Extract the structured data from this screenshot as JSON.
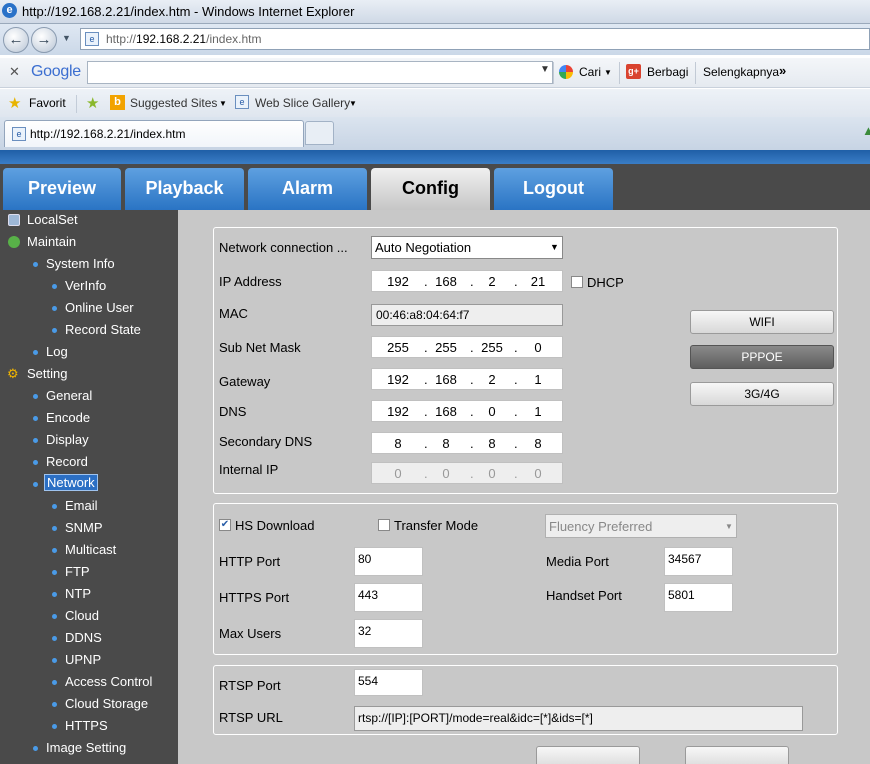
{
  "window": {
    "title": "http://192.168.2.21/index.htm - Windows Internet Explorer"
  },
  "address_bar": {
    "prefix": "http://",
    "host": "192.168.2.21",
    "path": "/index.htm"
  },
  "google_toolbar": {
    "logo": "Google",
    "search_label": "Cari",
    "share_label": "Berbagi",
    "more_label": "Selengkapnya"
  },
  "favorites_bar": {
    "favorites": "Favorit",
    "suggested": "Suggested Sites",
    "webslice": "Web Slice Gallery"
  },
  "tab": {
    "title": "http://192.168.2.21/index.htm"
  },
  "nav_tabs": [
    "Preview",
    "Playback",
    "Alarm",
    "Config",
    "Logout"
  ],
  "sidebar": {
    "localset": "LocalSet",
    "maintain": "Maintain",
    "system_info": "System Info",
    "verinfo": "VerInfo",
    "online_user": "Online User",
    "record_state": "Record State",
    "log": "Log",
    "setting": "Setting",
    "general": "General",
    "encode": "Encode",
    "display": "Display",
    "record": "Record",
    "network": "Network",
    "email": "Email",
    "snmp": "SNMP",
    "multicast": "Multicast",
    "ftp": "FTP",
    "ntp": "NTP",
    "cloud": "Cloud",
    "ddns": "DDNS",
    "upnp": "UPNP",
    "access_control": "Access Control",
    "cloud_storage": "Cloud Storage",
    "https": "HTTPS",
    "image_setting": "Image Setting"
  },
  "network": {
    "conn_label": "Network connection ...",
    "conn_value": "Auto Negotiation",
    "ip_label": "IP Address",
    "ip": [
      "192",
      "168",
      "2",
      "21"
    ],
    "dhcp_label": "DHCP",
    "mac_label": "MAC",
    "mac": "00:46:a8:04:64:f7",
    "mask_label": "Sub Net Mask",
    "mask": [
      "255",
      "255",
      "255",
      "0"
    ],
    "gateway_label": "Gateway",
    "gateway": [
      "192",
      "168",
      "2",
      "1"
    ],
    "dns_label": "DNS",
    "dns": [
      "192",
      "168",
      "0",
      "1"
    ],
    "sdns_label": "Secondary DNS",
    "sdns": [
      "8",
      "8",
      "8",
      "8"
    ],
    "internal_label": "Internal IP",
    "internal": [
      "0",
      "0",
      "0",
      "0"
    ],
    "btn_wifi": "WIFI",
    "btn_pppoe": "PPPOE",
    "btn_3g4g": "3G/4G"
  },
  "ports": {
    "hs_label": "HS Download",
    "transfer_label": "Transfer Mode",
    "fluency": "Fluency Preferred",
    "http_label": "HTTP Port",
    "http": "80",
    "https_label": "HTTPS Port",
    "https": "443",
    "max_label": "Max Users",
    "max": "32",
    "media_label": "Media Port",
    "media": "34567",
    "handset_label": "Handset Port",
    "handset": "5801"
  },
  "rtsp": {
    "port_label": "RTSP Port",
    "port": "554",
    "url_label": "RTSP URL",
    "url": "rtsp://[IP]:[PORT]/mode=real&idc=[*]&ids=[*]"
  }
}
